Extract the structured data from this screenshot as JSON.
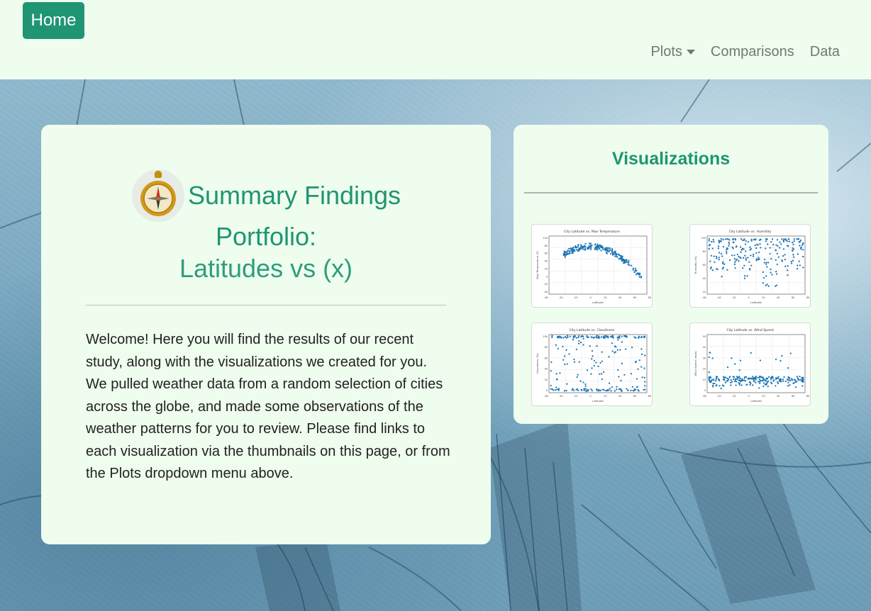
{
  "navbar": {
    "brand": "Home",
    "links": [
      {
        "label": "Plots",
        "dropdown": true
      },
      {
        "label": "Comparisons"
      },
      {
        "label": "Data"
      }
    ]
  },
  "summary": {
    "icon": "compass-icon",
    "title": "Summary Findings",
    "portfolio": "Portfolio:",
    "subtitle": "Latitudes vs (x)",
    "intro": "Welcome! Here you will find the results of our recent study, along with the visualizations we created for you. We pulled weather data from a random selection of cities across the globe, and made some observations of the weather patterns for you to review. Please find links to each visualization via the thumbnails on this page, or from the Plots dropdown menu above."
  },
  "visualizations": {
    "title": "Visualizations",
    "thumbnails": [
      {
        "title": "City Latitude vs. Max Temperature",
        "xlabel": "Latitude",
        "ylabel": "Max Temperature (F)",
        "pattern": "temperature",
        "xticks": [
          "-60",
          "-40",
          "-20",
          "0",
          "20",
          "40",
          "60",
          "80"
        ],
        "yticks": [
          "100",
          "80",
          "60",
          "40",
          "20",
          "0",
          "-20",
          "-40"
        ]
      },
      {
        "title": "City Latitude vs. Humidity",
        "xlabel": "Latitude",
        "ylabel": "Humidity (%)",
        "pattern": "humidity",
        "xticks": [
          "-60",
          "-40",
          "-20",
          "0",
          "20",
          "40",
          "60",
          "80"
        ],
        "yticks": [
          "100",
          "80",
          "60",
          "40",
          "20"
        ]
      },
      {
        "title": "City Latitude vs. Cloudiness",
        "xlabel": "Latitude",
        "ylabel": "Cloudiness (%)",
        "pattern": "cloudiness",
        "xticks": [
          "-60",
          "-40",
          "-20",
          "0",
          "20",
          "40",
          "60",
          "80"
        ],
        "yticks": [
          "100",
          "80",
          "60",
          "40",
          "20",
          "0"
        ]
      },
      {
        "title": "City Latitude vs. Wind Speed",
        "xlabel": "Latitude",
        "ylabel": "Wind Speed (mph)",
        "pattern": "wind",
        "xticks": [
          "-60",
          "-40",
          "-20",
          "0",
          "20",
          "40",
          "60",
          "80"
        ],
        "yticks": [
          "50",
          "40",
          "30",
          "20",
          "10",
          "0"
        ]
      }
    ]
  },
  "colors": {
    "accent": "#1f9573",
    "card_bg": "#eefdee",
    "point": "#1f77b4",
    "nav_text": "#6f7a72"
  }
}
